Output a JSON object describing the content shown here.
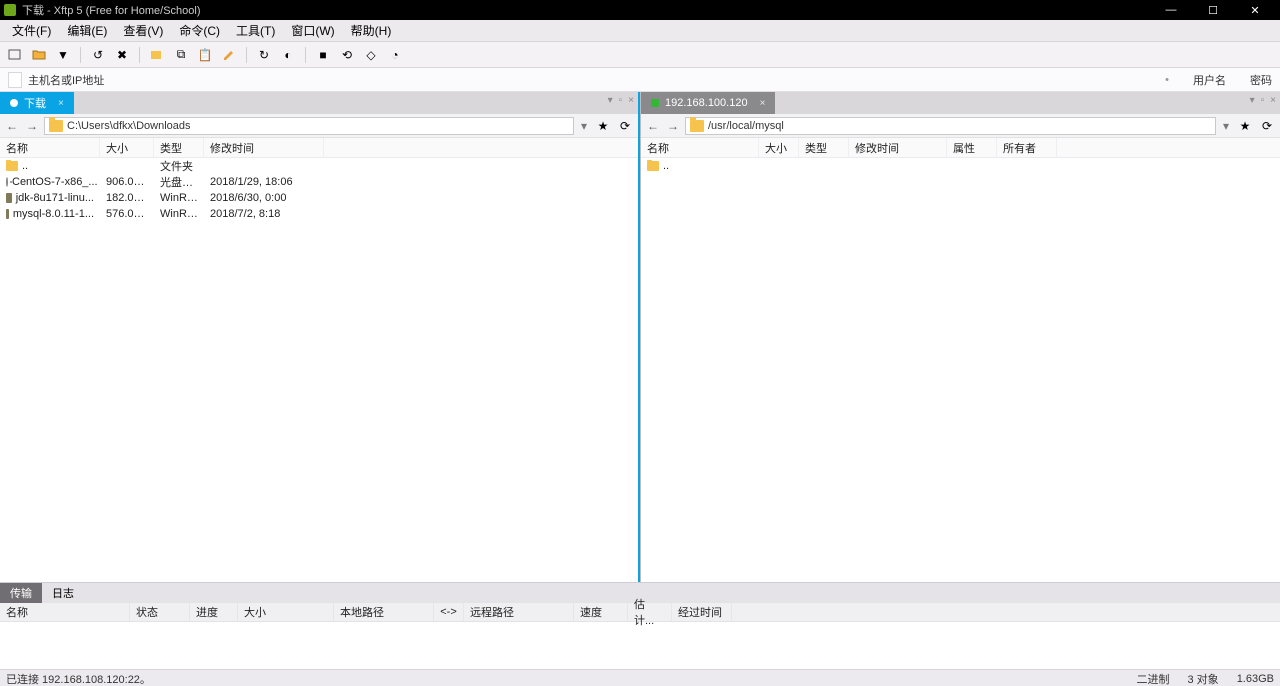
{
  "title": "下载 - Xftp 5 (Free for Home/School)",
  "window_controls": {
    "min": "—",
    "max": "☐",
    "close": "✕"
  },
  "menu": [
    "文件(F)",
    "编辑(E)",
    "查看(V)",
    "命令(C)",
    "工具(T)",
    "窗口(W)",
    "帮助(H)"
  ],
  "filter": {
    "placeholder": "主机名或IP地址",
    "right1": "用户名",
    "right2": "密码"
  },
  "left_pane": {
    "tab_label": "下载",
    "path": "C:\\Users\\dfkx\\Downloads",
    "columns": {
      "name": "名称",
      "size": "大小",
      "type": "类型",
      "mtime": "修改时间"
    },
    "rows": [
      {
        "icon": "folder",
        "name": "..",
        "size": "",
        "type": "文件夹",
        "mtime": ""
      },
      {
        "icon": "iso",
        "name": "CentOS-7-x86_...",
        "size": "906.00...",
        "type": "光盘映...",
        "mtime": "2018/1/29, 18:06"
      },
      {
        "icon": "archive",
        "name": "jdk-8u171-linu...",
        "size": "182.05...",
        "type": "WinRA...",
        "mtime": "2018/6/30, 0:00"
      },
      {
        "icon": "archive",
        "name": "mysql-8.0.11-1...",
        "size": "576.01...",
        "type": "WinRA...",
        "mtime": "2018/7/2, 8:18"
      }
    ]
  },
  "right_pane": {
    "tab_label": "192.168.100.120",
    "path": "/usr/local/mysql",
    "columns": {
      "name": "名称",
      "size": "大小",
      "type": "类型",
      "mtime": "修改时间",
      "attr": "属性",
      "owner": "所有者"
    },
    "rows": [
      {
        "icon": "folder",
        "name": "..",
        "size": "",
        "type": "",
        "mtime": "",
        "attr": "",
        "owner": ""
      }
    ]
  },
  "bottom_tabs": {
    "transfer": "传输",
    "log": "日志"
  },
  "xfer_columns": {
    "name": "名称",
    "status": "状态",
    "prog": "进度",
    "size": "大小",
    "local": "本地路径",
    "arrow": "<->",
    "remote": "远程路径",
    "speed": "速度",
    "eta": "估计...",
    "elapsed": "经过时间"
  },
  "status": {
    "left": "已连接 192.168.108.120:22。",
    "seg1": "二进制",
    "seg2": "3 对象",
    "seg3": "1.63GB"
  }
}
